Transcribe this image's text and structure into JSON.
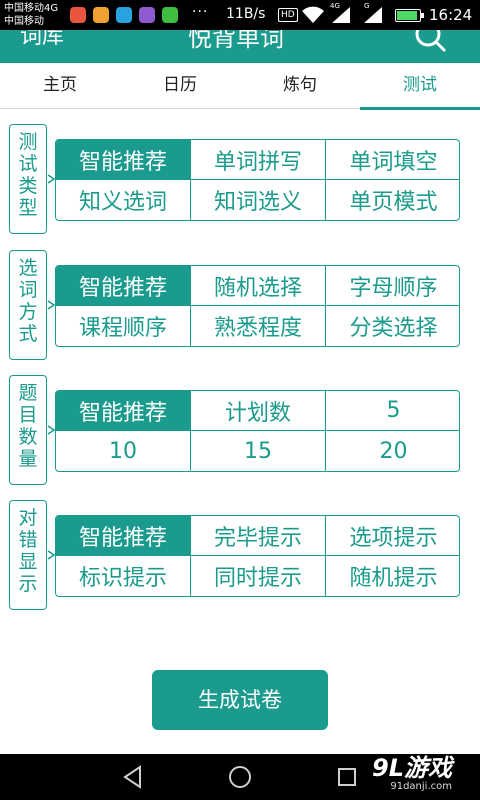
{
  "status_bar": {
    "carrier_primary": "中国移动4G",
    "carrier_secondary": "中国移动",
    "net_speed": "11B/s",
    "hd_badge": "HD",
    "sig1_label": "4G",
    "sig2_label": "G",
    "battery_level": 0.9,
    "time": "16:24"
  },
  "header": {
    "back_label": "词库",
    "title": "悦背单词"
  },
  "tabs": [
    {
      "label": "主页"
    },
    {
      "label": "日历"
    },
    {
      "label": "炼句"
    },
    {
      "label": "测试"
    }
  ],
  "active_tab": "测试",
  "sections": [
    {
      "label": [
        "测",
        "试",
        "类",
        "型"
      ],
      "options": [
        "智能推荐",
        "单词拼写",
        "单词填空",
        "知义选词",
        "知词选义",
        "单页模式"
      ],
      "selected": "智能推荐"
    },
    {
      "label": [
        "选",
        "词",
        "方",
        "式"
      ],
      "options": [
        "智能推荐",
        "随机选择",
        "字母顺序",
        "课程顺序",
        "熟悉程度",
        "分类选择"
      ],
      "selected": "智能推荐"
    },
    {
      "label": [
        "题",
        "目",
        "数",
        "量"
      ],
      "options": [
        "智能推荐",
        "计划数",
        "5",
        "10",
        "15",
        "20"
      ],
      "selected": "智能推荐"
    },
    {
      "label": [
        "对",
        "错",
        "显",
        "示"
      ],
      "options": [
        "智能推荐",
        "完毕提示",
        "选项提示",
        "标识提示",
        "同时提示",
        "随机提示"
      ],
      "selected": "智能推荐"
    }
  ],
  "generate_button": "生成试卷",
  "watermark": {
    "main": "9L游戏",
    "sub": "91danji.com"
  },
  "icons": {
    "search": "search-icon",
    "back": "back-triangle-icon",
    "home": "home-circle-icon",
    "recent": "recent-square-icon"
  },
  "colors": {
    "accent": "#1a9b8d",
    "text": "#222222"
  }
}
